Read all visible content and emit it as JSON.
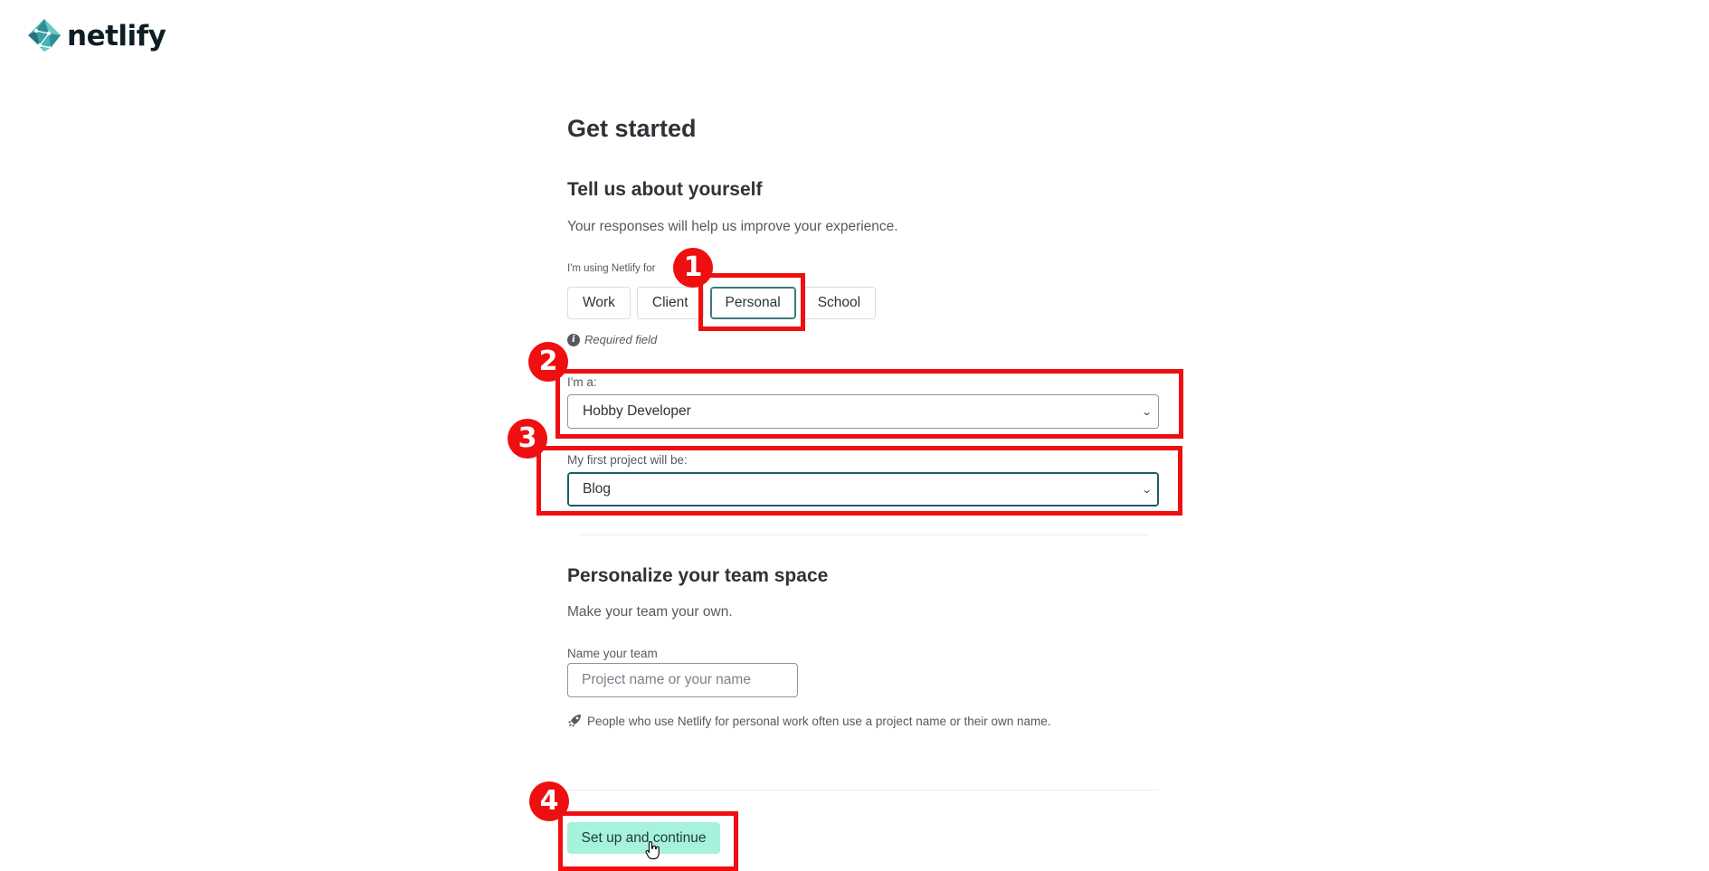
{
  "brand": {
    "name": "netlify",
    "logo_icon": "netlify-logo-icon",
    "logo_colors": [
      "#2e8f95",
      "#45b4b6",
      "#6cc8c6",
      "#2c6e7a"
    ]
  },
  "page": {
    "title": "Get started"
  },
  "about": {
    "title": "Tell us about yourself",
    "description": "Your responses will help us improve your experience.",
    "usage_label": "I'm using Netlify for",
    "usage_options": [
      "Work",
      "Client",
      "Personal",
      "School"
    ],
    "usage_selected": "Personal",
    "required_text": "Required field",
    "role_label": "I'm a:",
    "role_value": "Hobby Developer",
    "project_label": "My first project will be:",
    "project_value": "Blog"
  },
  "team": {
    "title": "Personalize your team space",
    "description": "Make your team your own.",
    "name_label": "Name your team",
    "name_placeholder": "Project name or your name",
    "name_value": "",
    "hint": "People who use Netlify for personal work often use a project name or their own name.",
    "hint_icon": "rocket-icon"
  },
  "actions": {
    "submit_label": "Set up and continue"
  },
  "annotations": {
    "color": "#ef0f10",
    "markers": [
      "1",
      "2",
      "3",
      "4"
    ]
  }
}
